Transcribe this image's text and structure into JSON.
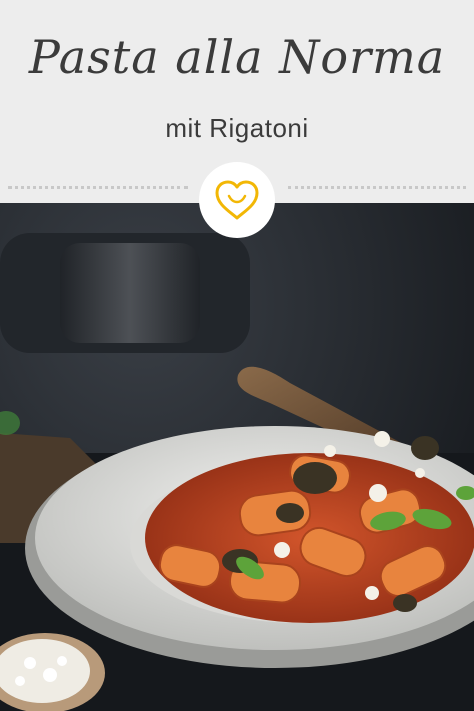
{
  "header": {
    "title": "Pasta alla Norma",
    "subtitle": "mit Rigatoni"
  },
  "badge": {
    "icon": "heart-logo-icon",
    "color": "#f2b705"
  },
  "photo": {
    "description_icon": "pasta-dish-photo"
  },
  "colors": {
    "header_bg": "#ededed",
    "text": "#3b3b3b",
    "accent": "#f2b705"
  }
}
